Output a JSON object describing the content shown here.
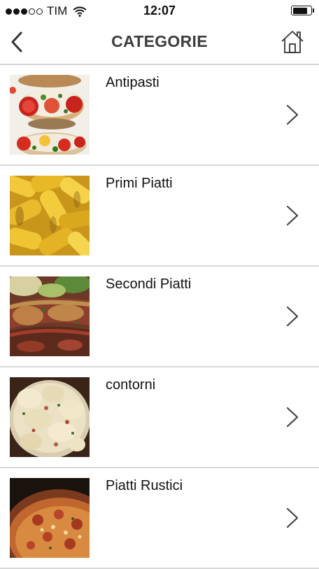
{
  "status_bar": {
    "carrier": "TIM",
    "time": "12:07",
    "signal_bars_filled": 3,
    "signal_bars_total": 5
  },
  "nav": {
    "title": "CATEGORIE",
    "back_icon": "chevron-left-icon",
    "home_icon": "home-icon"
  },
  "categories": [
    {
      "label": "Antipasti",
      "image": "bruschetta-photo"
    },
    {
      "label": "Primi Piatti",
      "image": "pasta-photo"
    },
    {
      "label": "Secondi Piatti",
      "image": "steak-photo"
    },
    {
      "label": "contorni",
      "image": "potato-salad-photo"
    },
    {
      "label": "Piatti Rustici",
      "image": "pizza-photo"
    }
  ],
  "colors": {
    "title": "#3c3c3c",
    "separator": "#d8d8d8",
    "background": "#ffffff"
  }
}
